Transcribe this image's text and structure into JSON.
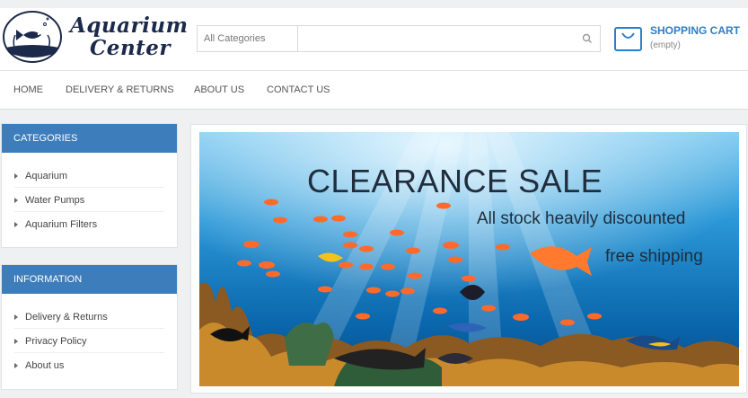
{
  "logo": {
    "line1": "Aquarium",
    "line2": "Center"
  },
  "search": {
    "category": "All Categories",
    "value": "",
    "placeholder": ""
  },
  "cart": {
    "title": "SHOPPING CART",
    "status": "(empty)"
  },
  "nav": [
    {
      "label": "HOME"
    },
    {
      "label": "DELIVERY & RETURNS"
    },
    {
      "label": "ABOUT US"
    },
    {
      "label": "CONTACT US"
    }
  ],
  "categories": {
    "title": "CATEGORIES",
    "items": [
      {
        "label": "Aquarium"
      },
      {
        "label": "Water Pumps"
      },
      {
        "label": "Aquarium Filters"
      }
    ]
  },
  "information": {
    "title": "INFORMATION",
    "items": [
      {
        "label": "Delivery & Returns"
      },
      {
        "label": "Privacy Policy"
      },
      {
        "label": "About us"
      }
    ]
  },
  "banner": {
    "title": "CLEARANCE SALE",
    "subtitle": "All stock heavily discounted",
    "shipping": "free shipping"
  },
  "colors": {
    "accent": "#3e7dbb",
    "cart_blue": "#2e7ec4",
    "ocean": "#0a72b8"
  }
}
